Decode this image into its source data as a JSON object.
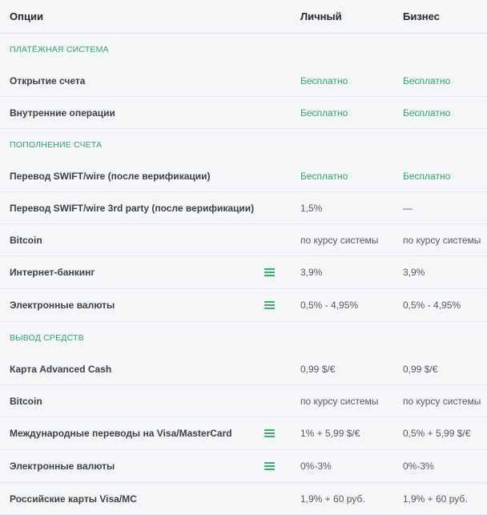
{
  "header": {
    "options": "Опции",
    "personal": "Личный",
    "business": "Бизнес"
  },
  "sections": [
    {
      "title": "ПЛАТЁЖНАЯ СИСТЕМА",
      "rows": [
        {
          "name": "Открытие счета",
          "personal": "Бесплатно",
          "business": "Бесплатно",
          "free": true,
          "menu": false
        },
        {
          "name": "Внутренние операции",
          "personal": "Бесплатно",
          "business": "Бесплатно",
          "free": true,
          "menu": false
        }
      ]
    },
    {
      "title": "ПОПОЛНЕНИЕ СЧЕТА",
      "rows": [
        {
          "name": "Перевод SWIFT/wire (после верификации)",
          "personal": "Бесплатно",
          "business": "Бесплатно",
          "free": true,
          "menu": false
        },
        {
          "name": "Перевод SWIFT/wire 3rd party (после верификации)",
          "personal": "1,5%",
          "business": "—",
          "free": false,
          "menu": false
        },
        {
          "name": "Bitcoin",
          "personal": "по курсу системы",
          "business": "по курсу системы",
          "free": false,
          "menu": false
        },
        {
          "name": "Интернет-банкинг",
          "personal": "3,9%",
          "business": "3,9%",
          "free": false,
          "menu": true
        },
        {
          "name": "Электронные валюты",
          "personal": "0,5% - 4,95%",
          "business": "0,5% - 4,95%",
          "free": false,
          "menu": true
        }
      ]
    },
    {
      "title": "ВЫВОД СРЕДСТВ",
      "rows": [
        {
          "name": "Карта Advanced Cash",
          "personal": "0,99 $/€",
          "business": "0,99 $/€",
          "free": false,
          "menu": false
        },
        {
          "name": "Bitcoin",
          "personal": "по курсу системы",
          "business": "по курсу системы",
          "free": false,
          "menu": false
        },
        {
          "name": "Международные переводы на Visa/MasterCard",
          "personal": "1% + 5,99 $/€",
          "business": "0,5% + 5,99 $/€",
          "free": false,
          "menu": true
        },
        {
          "name": "Электронные валюты",
          "personal": "0%-3%",
          "business": "0%-3%",
          "free": false,
          "menu": true
        },
        {
          "name": "Российские карты Visa/MC",
          "personal": "1,9% + 60 руб.",
          "business": "1,9% + 60 руб.",
          "free": false,
          "menu": false
        }
      ]
    }
  ],
  "colors": {
    "accent": "#2fa66a",
    "row_bg": "#f4f6f8",
    "border": "#e4e8eb"
  },
  "icons": {
    "expand": "menu-icon"
  }
}
